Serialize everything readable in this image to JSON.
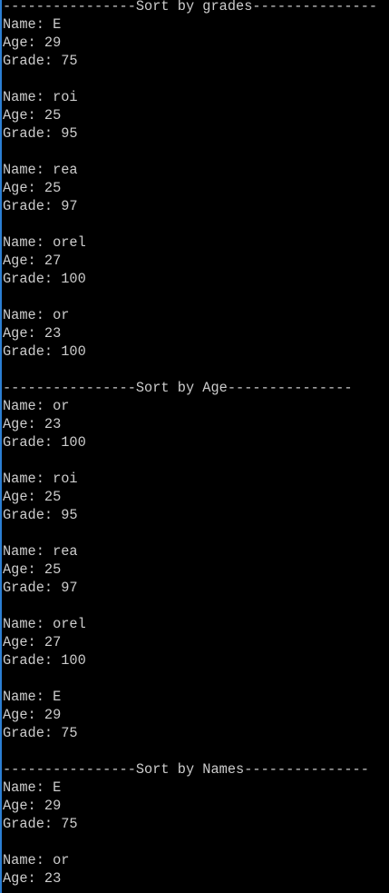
{
  "console": {
    "lines": [
      "----------------Sort by grades---------------",
      "Name: E",
      "Age: 29",
      "Grade: 75",
      "",
      "Name: roi",
      "Age: 25",
      "Grade: 95",
      "",
      "Name: rea",
      "Age: 25",
      "Grade: 97",
      "",
      "Name: orel",
      "Age: 27",
      "Grade: 100",
      "",
      "Name: or",
      "Age: 23",
      "Grade: 100",
      "",
      "----------------Sort by Age---------------",
      "Name: or",
      "Age: 23",
      "Grade: 100",
      "",
      "Name: roi",
      "Age: 25",
      "Grade: 95",
      "",
      "Name: rea",
      "Age: 25",
      "Grade: 97",
      "",
      "Name: orel",
      "Age: 27",
      "Grade: 100",
      "",
      "Name: E",
      "Age: 29",
      "Grade: 75",
      "",
      "----------------Sort by Names---------------",
      "Name: E",
      "Age: 29",
      "Grade: 75",
      "",
      "Name: or",
      "Age: 23"
    ]
  }
}
